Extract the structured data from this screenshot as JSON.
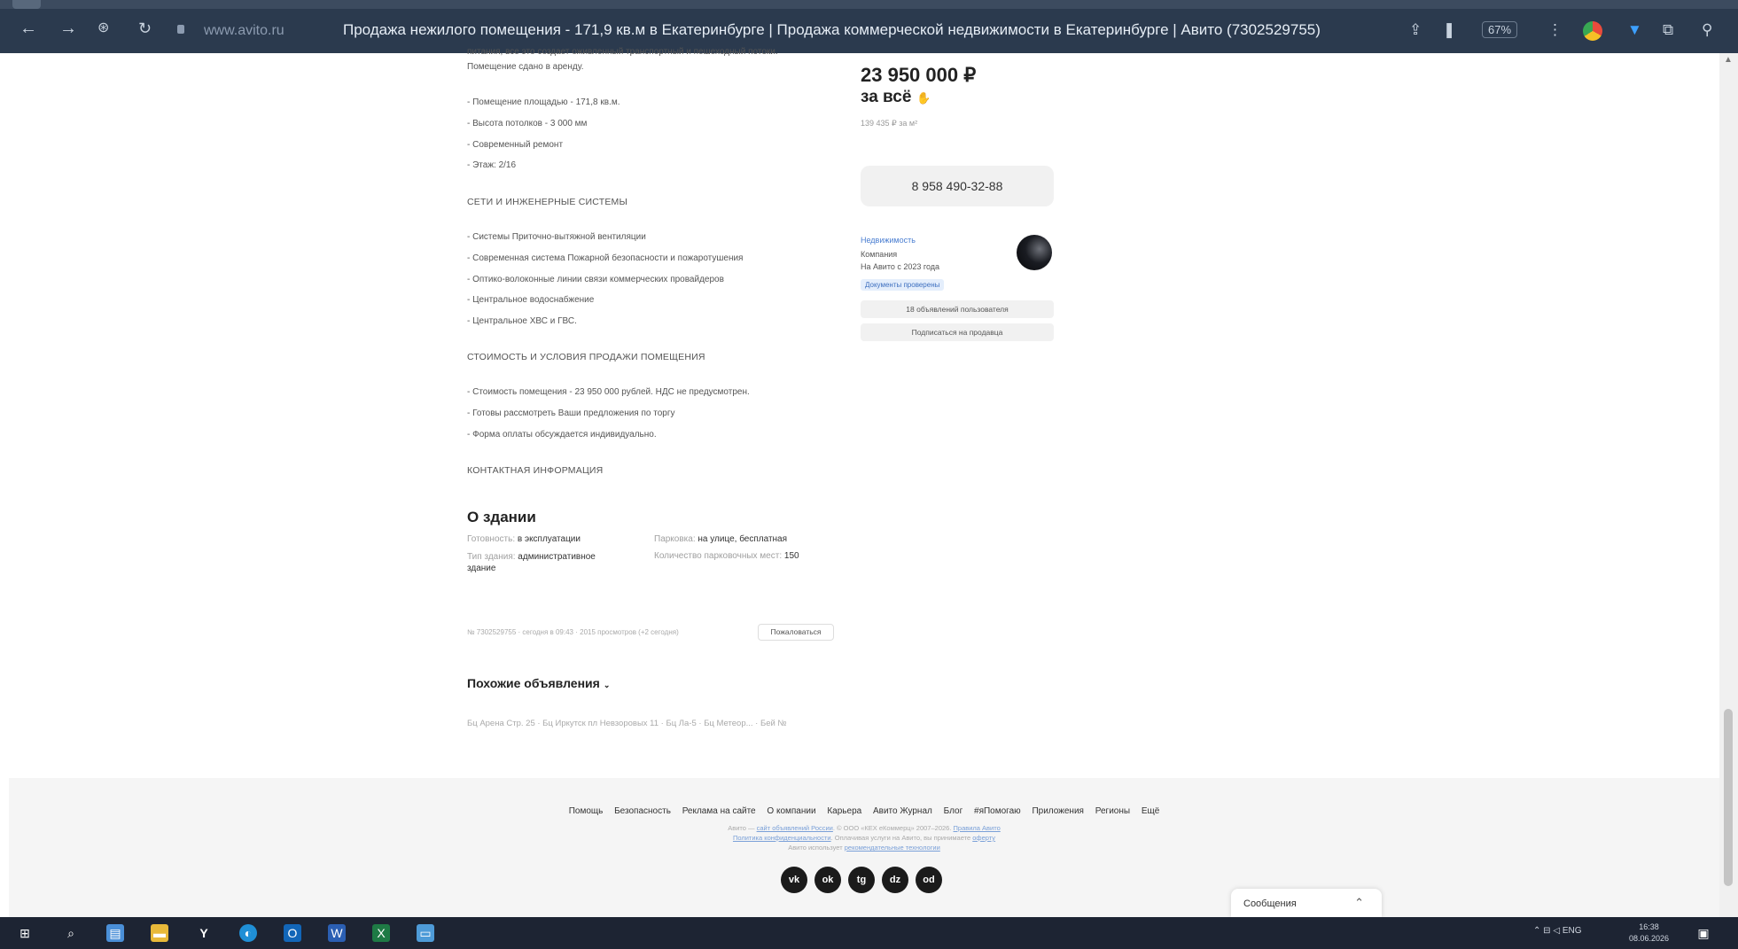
{
  "browser": {
    "url": "www.avito.ru",
    "title": "Продажа нежилого помещения - 171,9 кв.м в Екатеринбурге | Продажа коммерческой недвижимости в Екатеринбурге | Авито (7302529755)",
    "zoom": "67%"
  },
  "description": {
    "cut_line": "питания, все это создает оживленный транспортный и пешеходный потоки.",
    "rented": "Помещение сдано в аренду.",
    "features": [
      "- Помещение площадью - 171,8 кв.м.",
      "- Высота потолков - 3 000 мм",
      "- Современный ремонт",
      "- Этаж: 2/16"
    ],
    "networks_title": "СЕТИ И ИНЖЕНЕРНЫЕ СИСТЕМЫ",
    "networks": [
      "- Системы Приточно-вытяжной вентиляции",
      "- Современная система Пожарной безопасности и пожаротушения",
      "- Оптико-волоконные линии связи коммерческих провайдеров",
      "- Центральное водоснабжение",
      "- Центральное ХВС и ГВС."
    ],
    "cost_title": "СТОИМОСТЬ И УСЛОВИЯ ПРОДАЖИ ПОМЕЩЕНИЯ",
    "cost": [
      "- Стоимость помещения - 23 950 000 рублей. НДС не предусмотрен.",
      "- Готовы рассмотреть Ваши предложения по торгу",
      "- Форма оплаты обсуждается индивидуально."
    ],
    "contact_title": "КОНТАКТНАЯ ИНФОРМАЦИЯ"
  },
  "sidebar": {
    "price": "23 950 000 ₽",
    "price_sub": "за всё",
    "price_per_m2": "139 435 ₽ за м²",
    "phone": "8 958 490-32-88",
    "seller_name": "Недвижимость",
    "seller_type": "Компания",
    "seller_since": "На Авито с 2023 года",
    "docs_checked": "Документы проверены",
    "ads_button": "18 объявлений пользователя",
    "subscribe_button": "Подписаться на продавца"
  },
  "about": {
    "title": "О здании",
    "rows": [
      {
        "key": "Готовность",
        "value": "в эксплуатации"
      },
      {
        "key": "Тип здания",
        "value": "административное здание"
      },
      {
        "key": "Парковка",
        "value": "на улице, бесплатная"
      },
      {
        "key": "Количество парковочных мест",
        "value": "150"
      }
    ]
  },
  "meta": {
    "info": "№ 7302529755 · сегодня в 09:43 · 2015 просмотров (+2 сегодня)",
    "complain": "Пожаловаться"
  },
  "similar": {
    "title": "Похожие объявления",
    "breadcrumbs": "Бц Арена Стр. 25 · Бц Иркутск пл Невзоровых 11 · Бц Ла-5 · Бц Метеор... · Бей №"
  },
  "footer": {
    "links": [
      "Помощь",
      "Безопасность",
      "Реклама на сайте",
      "О компании",
      "Карьера",
      "Авито Журнал",
      "Блог",
      "#яПомогаю",
      "Приложения",
      "Регионы",
      "Ещё"
    ],
    "legal1_pre": "Авито — ",
    "legal1_link": "сайт объявлений России",
    "legal1_post": ". © ООО «КЕХ еКоммерц» 2007–2026. ",
    "legal1_link2": "Правила Авито",
    "legal2_link": "Политика конфиденциальности",
    "legal2_post": ". Оплачивая услуги на Авито, вы принимаете ",
    "legal2_link2": "оферту",
    "legal3_pre": "Авито использует ",
    "legal3_link": "рекомендательные технологии",
    "socials": [
      "vk",
      "ok",
      "tg",
      "dz",
      "od"
    ]
  },
  "messages": {
    "label": "Сообщения"
  },
  "taskbar": {
    "lang": "ENG",
    "time": "16:38",
    "date": "08.06.2026"
  },
  "colors": {
    "chrome": "#2b3a4e",
    "taskbar": "#1d2433",
    "link": "#4a7ed1",
    "button_bg": "#f1f1f1",
    "footer_bg": "#f5f5f5"
  }
}
